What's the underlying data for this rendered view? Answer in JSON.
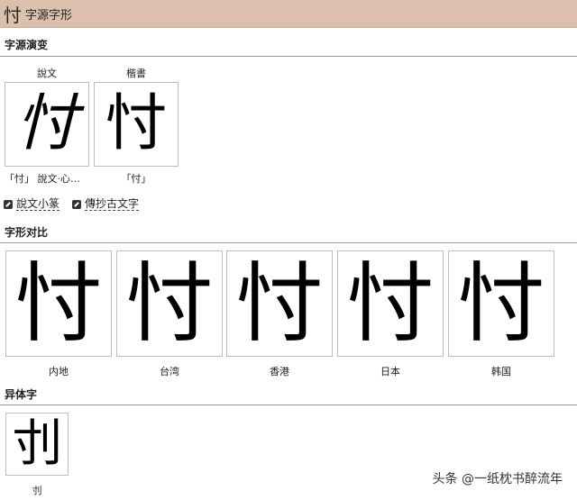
{
  "header": {
    "char": "忖",
    "title": "字源字形"
  },
  "evolution": {
    "title": "字源演变",
    "items": [
      {
        "style_label": "說文",
        "glyph": "忖",
        "caption": "「忖」 說文‧心…"
      },
      {
        "style_label": "楷書",
        "glyph": "忖",
        "caption": "「忖」"
      }
    ],
    "links": [
      {
        "label": "說文小篆"
      },
      {
        "label": "傳抄古文字"
      }
    ]
  },
  "comparison": {
    "title": "字形对比",
    "items": [
      {
        "glyph": "忖",
        "label": "内地"
      },
      {
        "glyph": "忖",
        "label": "台湾"
      },
      {
        "glyph": "忖",
        "label": "香港"
      },
      {
        "glyph": "忖",
        "label": "日本"
      },
      {
        "glyph": "忖",
        "label": "韩国"
      }
    ]
  },
  "variants": {
    "title": "异体字",
    "items": [
      {
        "glyph": "刌",
        "label": "刌"
      }
    ]
  },
  "watermark": "头条 @一纸枕书醉流年"
}
